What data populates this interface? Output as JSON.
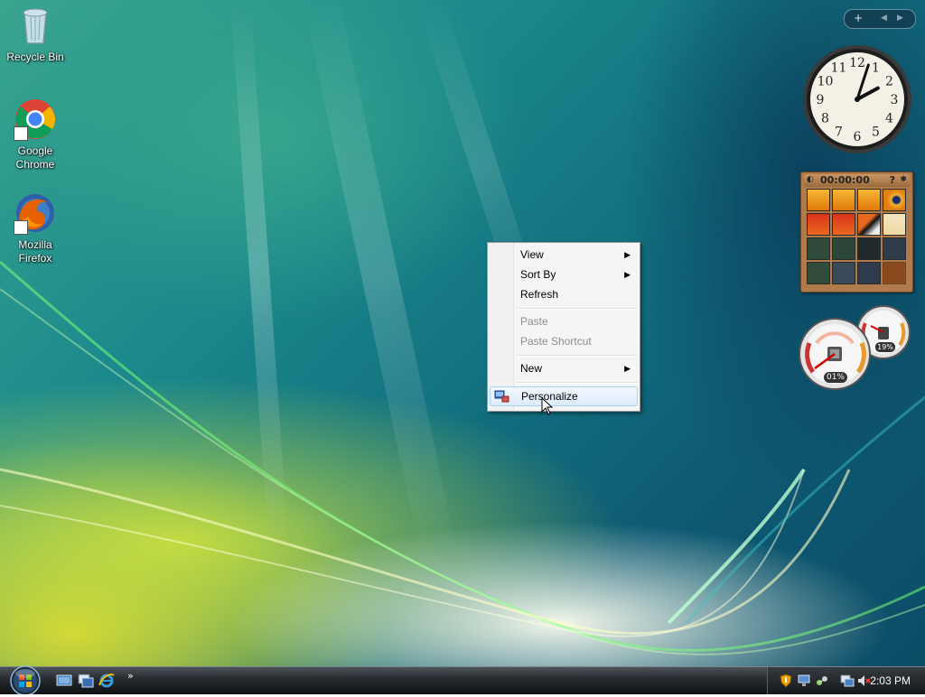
{
  "desktop": {
    "icons": [
      {
        "label_line1": "Recycle Bin",
        "label_line2": ""
      },
      {
        "label_line1": "Google",
        "label_line2": "Chrome"
      },
      {
        "label_line1": "Mozilla",
        "label_line2": "Firefox"
      }
    ]
  },
  "context_menu": {
    "items": [
      {
        "label": "View",
        "submenu": true,
        "enabled": true
      },
      {
        "label": "Sort By",
        "submenu": true,
        "enabled": true
      },
      {
        "label": "Refresh",
        "submenu": false,
        "enabled": true
      },
      {
        "label": "Paste",
        "submenu": false,
        "enabled": false
      },
      {
        "label": "Paste Shortcut",
        "submenu": false,
        "enabled": false
      },
      {
        "label": "New",
        "submenu": true,
        "enabled": true
      },
      {
        "label": "Personalize",
        "submenu": false,
        "enabled": true,
        "highlighted": true,
        "icon": "personalize-icon"
      }
    ],
    "submenu_glyph": "▶"
  },
  "gadgets": {
    "toolbar": {
      "add": "+",
      "prev": "◀",
      "next": "▶"
    },
    "clock": {
      "numerals": [
        "12",
        "1",
        "2",
        "3",
        "4",
        "5",
        "6",
        "7",
        "8",
        "9",
        "10",
        "11"
      ],
      "hour": 2,
      "minute": 3
    },
    "puzzle": {
      "timer": "00:00:00",
      "help": "?"
    },
    "cpu_meter": {
      "cpu": "01%",
      "memory": "19%"
    }
  },
  "taskbar": {
    "chevron": "»",
    "quick_launch": [
      "show-desktop-icon",
      "switch-windows-icon",
      "internet-explorer-icon"
    ],
    "tray_icons": [
      "security-shield-icon",
      "network-icon",
      "connection-icon",
      "display-icon",
      "volume-muted-icon"
    ],
    "time": "2:03 PM"
  },
  "colors": {
    "menu_highlight": "#dcebfc",
    "taskbar": "#1a1d20",
    "disabled_text": "#8d8d8d"
  }
}
